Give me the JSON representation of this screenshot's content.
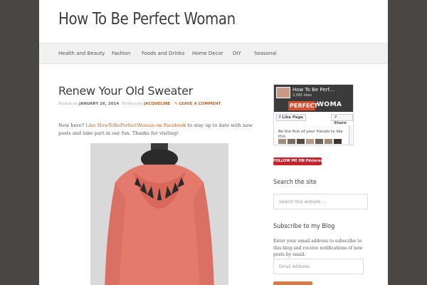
{
  "site": {
    "title": "How To Be Perfect Woman"
  },
  "nav": {
    "items": [
      "Health and Beauty",
      "Fashion",
      "Foods and Drinks",
      "Home Decor",
      "DIY",
      "Seasonal"
    ]
  },
  "post": {
    "title": "Renew Your Old Sweater",
    "posted_on": "Posted on",
    "date": "JANUARY 26, 2014",
    "written_by": "Written by",
    "author": "JACQUELINE",
    "leave_comment": "LEAVE A COMMENT",
    "intro_before": "New here? ",
    "intro_link": "Like HowToBePerfectWoman on Facebook",
    "intro_after": " to stay up to date with new posts and take part in our fun. Thanks for visiting!"
  },
  "facebook": {
    "page_name": "How To Be Perf...",
    "likes": "2,085 likes",
    "logo_text": "PERFECT",
    "logo_word2": "WOMA",
    "like_btn": "Like Page",
    "share_btn": "Share",
    "friends_text": "Be the first of your friends to like this"
  },
  "pinterest": {
    "label": "FOLLOW ME ON Pinterest"
  },
  "search": {
    "heading": "Search the site",
    "placeholder": "Search this website ..."
  },
  "subscribe": {
    "heading": "Subscribe to my Blog",
    "text": "Enter your email address to subscribe to this blog and receive notifications of new posts by email.",
    "placeholder": "Email Address"
  },
  "colors": {
    "accent": "#c0632c",
    "background": "#4a4643",
    "sweater": "#e47a6c"
  }
}
